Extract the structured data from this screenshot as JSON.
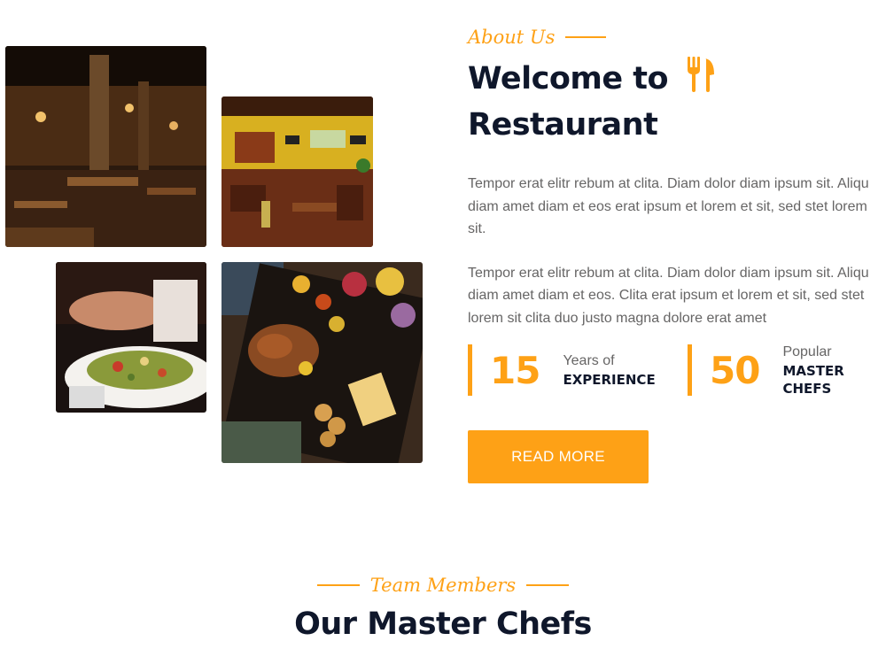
{
  "images": {
    "img1_alt": "Restaurant interior with wooden tables",
    "img2_alt": "Restaurant dining room with yellow walls",
    "img3_alt": "Person eating a salad",
    "img4_alt": "Grilled food platter on a wooden table"
  },
  "about": {
    "subtitle": "About Us",
    "heading_line1": "Welcome to",
    "heading_line2": "Restaurant",
    "heading_icon": "utensils-icon",
    "paragraph1": "Tempor erat elitr rebum at clita. Diam dolor diam ipsum sit. Aliqu diam amet diam et eos erat ipsum et lorem et sit, sed stet lorem sit.",
    "paragraph2": "Tempor erat elitr rebum at clita. Diam dolor diam ipsum sit. Aliqu diam amet diam et eos. Clita erat ipsum et lorem et sit, sed stet lorem sit clita duo justo magna dolore erat amet"
  },
  "stats": [
    {
      "number": "15",
      "top": "Years of",
      "bottom": "EXPERIENCE"
    },
    {
      "number": "50",
      "top": "Popular",
      "bottom": "MASTER CHEFS"
    }
  ],
  "button": {
    "label": "READ MORE"
  },
  "team": {
    "subtitle": "Team Members",
    "heading": "Our Master Chefs"
  },
  "colors": {
    "accent": "#FEA116",
    "dark": "#0F172B",
    "body_text": "#666565"
  }
}
